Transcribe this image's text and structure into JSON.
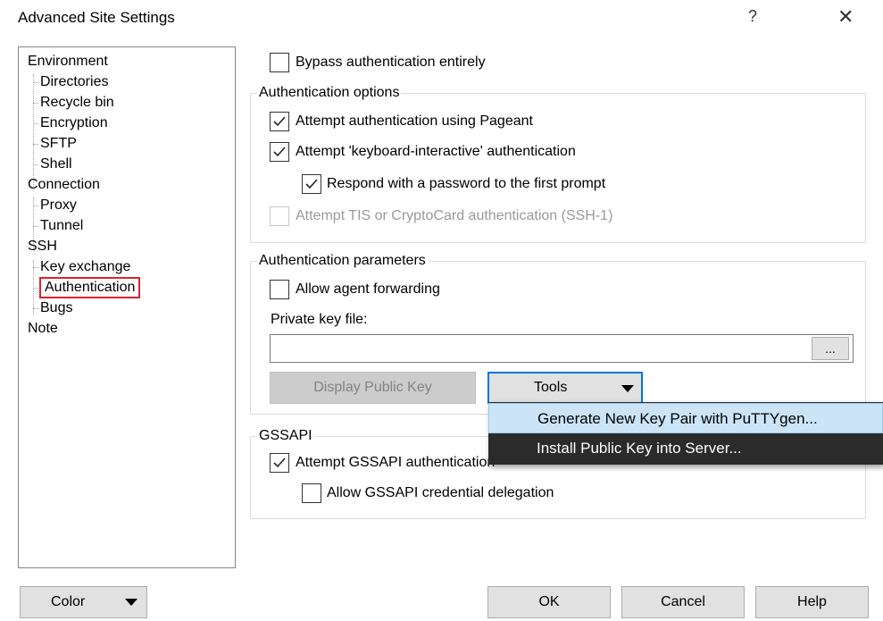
{
  "window": {
    "title": "Advanced Site Settings",
    "help_glyph": "?",
    "close_glyph": "✕"
  },
  "tree": {
    "items": [
      {
        "label": "Environment",
        "level": 0
      },
      {
        "label": "Directories",
        "level": 1
      },
      {
        "label": "Recycle bin",
        "level": 1
      },
      {
        "label": "Encryption",
        "level": 1
      },
      {
        "label": "SFTP",
        "level": 1
      },
      {
        "label": "Shell",
        "level": 1
      },
      {
        "label": "Connection",
        "level": 0
      },
      {
        "label": "Proxy",
        "level": 1
      },
      {
        "label": "Tunnel",
        "level": 1
      },
      {
        "label": "SSH",
        "level": 0
      },
      {
        "label": "Key exchange",
        "level": 1
      },
      {
        "label": "Authentication",
        "level": 1,
        "selected": true
      },
      {
        "label": "Bugs",
        "level": 1
      },
      {
        "label": "Note",
        "level": 0
      }
    ]
  },
  "bypass": {
    "label": "Bypass authentication entirely",
    "checked": false
  },
  "auth_options": {
    "title": "Authentication options",
    "pageant": {
      "label": "Attempt authentication using Pageant",
      "checked": true
    },
    "keyboard_interactive": {
      "label": "Attempt 'keyboard-interactive' authentication",
      "checked": true
    },
    "respond_password": {
      "label": "Respond with a password to the first prompt",
      "checked": true
    },
    "tis": {
      "label": "Attempt TIS or CryptoCard authentication (SSH-1)",
      "checked": false,
      "disabled": true
    }
  },
  "auth_params": {
    "title": "Authentication parameters",
    "agent_forwarding": {
      "label": "Allow agent forwarding",
      "checked": false
    },
    "private_key_label": "Private key file:",
    "private_key_value": "",
    "browse_label": "...",
    "display_public_key": "Display Public Key",
    "tools": "Tools"
  },
  "tools_menu": [
    {
      "label": "Generate New Key Pair with PuTTYgen...",
      "highlighted": true
    },
    {
      "label": "Install Public Key into Server...",
      "highlighted": false
    }
  ],
  "gssapi": {
    "title": "GSSAPI",
    "attempt": {
      "label": "Attempt GSSAPI authentication",
      "checked": true
    },
    "delegation": {
      "label": "Allow GSSAPI credential delegation",
      "checked": false
    }
  },
  "footer": {
    "color": "Color",
    "ok": "OK",
    "cancel": "Cancel",
    "help": "Help"
  },
  "colors": {
    "selection_border": "#e0232c",
    "menu_bg": "#2b2b2b",
    "menu_highlight": "#cce4f7",
    "focus": "#0078d7"
  }
}
